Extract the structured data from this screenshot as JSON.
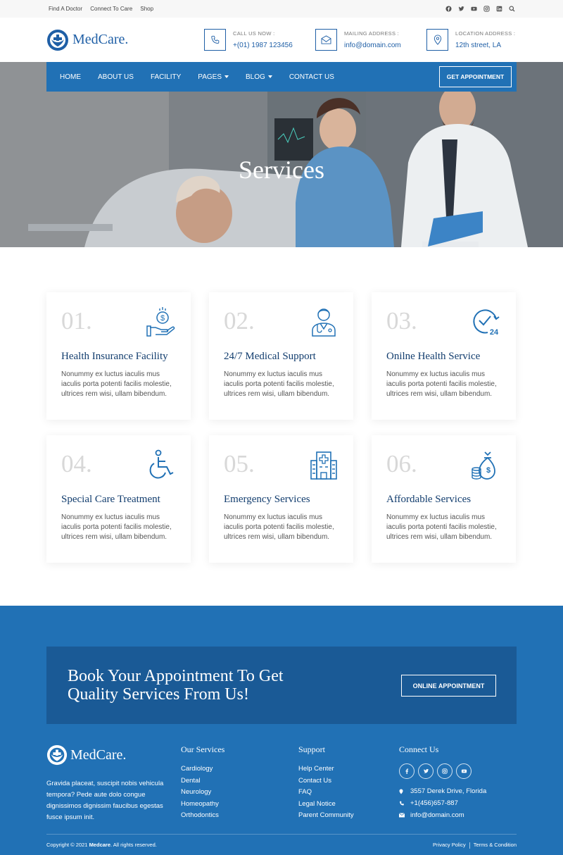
{
  "topbar": {
    "links": [
      "Find A Doctor",
      "Connect To Care",
      "Shop"
    ],
    "social_icons": [
      "facebook-icon",
      "twitter-icon",
      "youtube-icon",
      "instagram-icon",
      "linkedin-icon",
      "search-icon"
    ]
  },
  "brand": {
    "name": "MedCare."
  },
  "header": {
    "contacts": [
      {
        "label": "CALL US NOW :",
        "value": "+(01) 1987 123456",
        "icon": "phone-icon"
      },
      {
        "label": "MAILING ADDRESS :",
        "value": "info@domain.com",
        "icon": "mail-icon"
      },
      {
        "label": "LOCATION ADDRESS :",
        "value": "12th street, LA",
        "icon": "location-pin-icon"
      }
    ]
  },
  "nav": {
    "items": [
      {
        "label": "HOME",
        "dropdown": false
      },
      {
        "label": "ABOUT US",
        "dropdown": false
      },
      {
        "label": "FACILITY",
        "dropdown": false
      },
      {
        "label": "PAGES",
        "dropdown": true
      },
      {
        "label": "BLOG",
        "dropdown": true
      },
      {
        "label": "CONTACT US",
        "dropdown": false
      }
    ],
    "cta": "GET APPOINTMENT"
  },
  "hero": {
    "title": "Services"
  },
  "services": [
    {
      "num": "01.",
      "title": "Health Insurance Facility",
      "desc": "Nonummy ex luctus iaculis mus iaculis porta potenti facilis molestie, ultrices rem wisi, ullam bibendum.",
      "icon": "hand-coin-icon"
    },
    {
      "num": "02.",
      "title": "24/7 Medical Support",
      "desc": "Nonummy ex luctus iaculis mus iaculis porta potenti facilis molestie, ultrices rem wisi, ullam bibendum.",
      "icon": "doctor-icon"
    },
    {
      "num": "03.",
      "title": "Onilne Health Service",
      "desc": "Nonummy ex luctus iaculis mus iaculis porta potenti facilis molestie, ultrices rem wisi, ullam bibendum.",
      "icon": "clock-24-icon"
    },
    {
      "num": "04.",
      "title": "Special Care Treatment",
      "desc": "Nonummy ex luctus iaculis mus iaculis porta potenti facilis molestie, ultrices rem wisi, ullam bibendum.",
      "icon": "wheelchair-icon"
    },
    {
      "num": "05.",
      "title": "Emergency Services",
      "desc": "Nonummy ex luctus iaculis mus iaculis porta potenti facilis molestie, ultrices rem wisi, ullam bibendum.",
      "icon": "hospital-icon"
    },
    {
      "num": "06.",
      "title": "Affordable Services",
      "desc": "Nonummy ex luctus iaculis mus iaculis porta potenti facilis molestie, ultrices rem wisi, ullam bibendum.",
      "icon": "money-bag-icon"
    }
  ],
  "cta": {
    "line1": "Book Your Appointment To Get",
    "line2": "Quality Services From Us!",
    "button": "ONLINE APPOINTMENT"
  },
  "footer": {
    "about": "Gravida placeat, suscipit nobis vehicula tempora? Pede aute dolo congue dignissimos dignissim faucibus egestas fusce ipsum init.",
    "services_title": "Our Services",
    "services": [
      "Cardiology",
      "Dental",
      "Neurology",
      "Homeopathy",
      "Orthodontics"
    ],
    "support_title": "Support",
    "support": [
      "Help Center",
      "Contact Us",
      "FAQ",
      "Legal Notice",
      "Parent Community"
    ],
    "connect_title": "Connect Us",
    "social_icons": [
      "facebook-icon",
      "twitter-icon",
      "instagram-icon",
      "youtube-icon"
    ],
    "address": "3557 Derek Drive, Florida",
    "phone": "+1(456)657-887",
    "email": "info@domain.com",
    "copyright_prefix": "Copyright © 2021 ",
    "copyright_brand": "Medcare",
    "copyright_suffix": ". All rights reserved.",
    "privacy": "Privacy Policy",
    "terms": "Terms & Condition"
  },
  "colors": {
    "primary": "#2171b5",
    "dark_blue": "#1a5a96",
    "title_blue": "#123d6e"
  }
}
